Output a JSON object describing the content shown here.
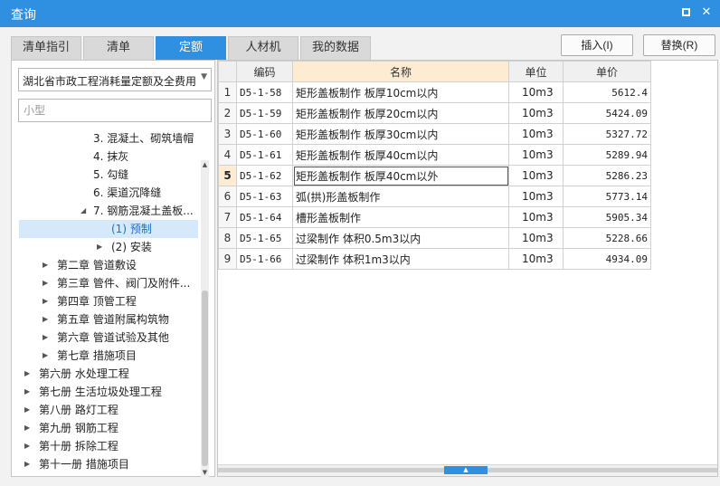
{
  "window": {
    "title": "查询",
    "maximize_icon": "maximize-icon",
    "close_icon": "close-icon",
    "close_glyph": "✕"
  },
  "tabs": [
    {
      "label": "清单指引",
      "active": false
    },
    {
      "label": "清单",
      "active": false
    },
    {
      "label": "定额",
      "active": true
    },
    {
      "label": "人材机",
      "active": false
    },
    {
      "label": "我的数据",
      "active": false
    }
  ],
  "actions": {
    "insert_label": "插入(I)",
    "replace_label": "替换(R)"
  },
  "library_select": {
    "value": "湖北省市政工程消耗量定额及全费用"
  },
  "search": {
    "value": "",
    "placeholder": "小型"
  },
  "tree": [
    {
      "label": "3. 混凝土、砌筑墙帽"
    },
    {
      "label": "4. 抹灰"
    },
    {
      "label": "5. 勾缝"
    },
    {
      "label": "6. 渠道沉降缝"
    },
    {
      "label": "7. 钢筋混凝土盖板..."
    },
    {
      "label": "(1) 预制"
    },
    {
      "label": "(2) 安装"
    },
    {
      "label": "第二章 管道敷设"
    },
    {
      "label": "第三章 管件、阀门及附件..."
    },
    {
      "label": "第四章 顶管工程"
    },
    {
      "label": "第五章 管道附属构筑物"
    },
    {
      "label": "第六章 管道试验及其他"
    },
    {
      "label": "第七章 措施项目"
    },
    {
      "label": "第六册 水处理工程"
    },
    {
      "label": "第七册 生活垃圾处理工程"
    },
    {
      "label": "第八册 路灯工程"
    },
    {
      "label": "第九册 钢筋工程"
    },
    {
      "label": "第十册 拆除工程"
    },
    {
      "label": "第十一册 措施项目"
    }
  ],
  "grid": {
    "headers": {
      "code": "编码",
      "name": "名称",
      "unit": "单位",
      "price": "单价"
    },
    "current_row": 5,
    "rows": [
      {
        "no": "1",
        "code": "D5-1-58",
        "name": "矩形盖板制作 板厚10cm以内",
        "unit": "10m3",
        "price": "5612.4"
      },
      {
        "no": "2",
        "code": "D5-1-59",
        "name": "矩形盖板制作 板厚20cm以内",
        "unit": "10m3",
        "price": "5424.09"
      },
      {
        "no": "3",
        "code": "D5-1-60",
        "name": "矩形盖板制作 板厚30cm以内",
        "unit": "10m3",
        "price": "5327.72"
      },
      {
        "no": "4",
        "code": "D5-1-61",
        "name": "矩形盖板制作 板厚40cm以内",
        "unit": "10m3",
        "price": "5289.94"
      },
      {
        "no": "5",
        "code": "D5-1-62",
        "name": "矩形盖板制作 板厚40cm以外",
        "unit": "10m3",
        "price": "5286.23"
      },
      {
        "no": "6",
        "code": "D5-1-63",
        "name": "弧(拱)形盖板制作",
        "unit": "10m3",
        "price": "5773.14"
      },
      {
        "no": "7",
        "code": "D5-1-64",
        "name": "槽形盖板制作",
        "unit": "10m3",
        "price": "5905.34"
      },
      {
        "no": "8",
        "code": "D5-1-65",
        "name": "过梁制作 体积0.5m3以内",
        "unit": "10m3",
        "price": "5228.66"
      },
      {
        "no": "9",
        "code": "D5-1-66",
        "name": "过梁制作 体积1m3以内",
        "unit": "10m3",
        "price": "4934.09"
      }
    ]
  },
  "colors": {
    "accent": "#2f8fe0",
    "header_highlight": "#fdebd2",
    "selection": "#d6e9fb"
  }
}
